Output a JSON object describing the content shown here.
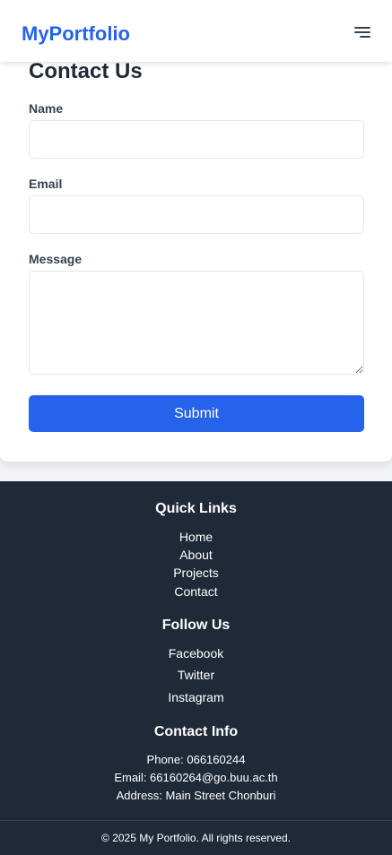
{
  "navbar": {
    "brand": "MyPortfolio",
    "menu_icon": "hamburger-menu-icon"
  },
  "contact": {
    "title": "Contact Us",
    "name_label": "Name",
    "name_value": "",
    "email_label": "Email",
    "email_value": "",
    "message_label": "Message",
    "message_value": "",
    "submit_label": "Submit"
  },
  "footer": {
    "quick_links_heading": "Quick Links",
    "quick_links": [
      "Home",
      "About",
      "Projects",
      "Contact"
    ],
    "follow_heading": "Follow Us",
    "social_links": [
      "Facebook",
      "Twitter",
      "Instagram"
    ],
    "contact_heading": "Contact Info",
    "phone": "Phone: 066160244",
    "email": "Email: 66160264@go.buu.ac.th",
    "address": "Address: Main Street Chonburi",
    "copyright": "© 2025 My Portfolio. All rights reserved."
  },
  "colors": {
    "brand": "#2563eb",
    "footer_bg": "#1f2937",
    "page_bg": "#f3f4f6"
  }
}
